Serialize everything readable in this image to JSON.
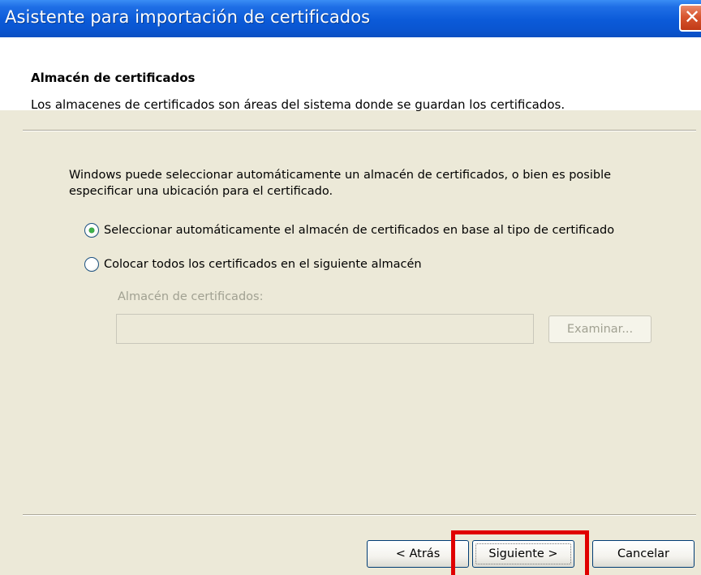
{
  "window": {
    "title": "Asistente para importación de certificados",
    "close_glyph": "✕"
  },
  "header": {
    "title": "Almacén de certificados",
    "subtitle": "Los almacenes de certificados son áreas del sistema donde se guardan los certificados."
  },
  "body": {
    "description": "Windows puede seleccionar automáticamente un almacén de certificados, o bien es posible especificar una ubicación para el certificado.",
    "options": [
      {
        "label": "Seleccionar automáticamente el almacén de certificados en base al tipo de certificado",
        "selected": true
      },
      {
        "label": "Colocar todos los certificados en el siguiente almacén",
        "selected": false
      }
    ],
    "store_label": "Almacén de certificados:",
    "store_value": "",
    "browse_label": "Examinar..."
  },
  "footer": {
    "back_label": "< Atrás",
    "next_label": "Siguiente >",
    "cancel_label": "Cancelar"
  },
  "colors": {
    "titlebar": "#0b5ad8",
    "dialog_bg": "#ece9d8",
    "highlight": "#e00000",
    "radio_dot": "#3fb24a"
  },
  "icons": {
    "close": "close-icon",
    "radio_selected": "radio-selected-icon",
    "radio_unselected": "radio-unselected-icon"
  }
}
